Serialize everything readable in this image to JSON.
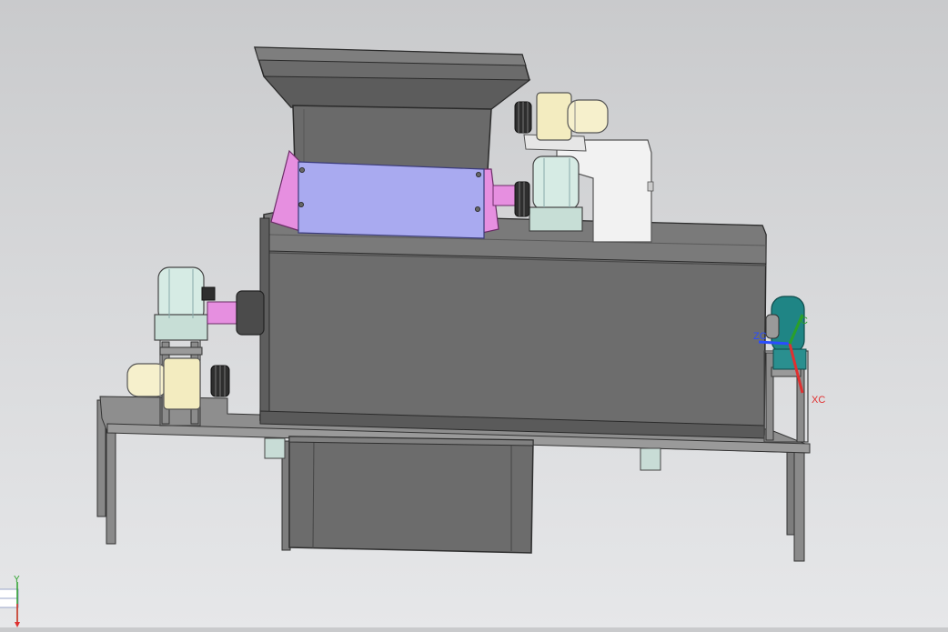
{
  "viewport": {
    "background_top": "#c9cacc",
    "background_bottom": "#e6e7e9"
  },
  "model": {
    "colors": {
      "body": "#6e6e6e",
      "frame": "#8c8c8c",
      "hopper": "#6a6a6a",
      "panel": "#a9aaf0",
      "pink": "#e68fe0",
      "bearing": "#d6ebe4",
      "motor": "#f3ecc0",
      "bracket": "#f2f2f2",
      "teal_bearing": "#1f8585"
    }
  },
  "wcs_triad": {
    "zc_label": "ZC",
    "xc_label": "XC",
    "yc_label": "C",
    "z_color": "#2a4dff",
    "x_color": "#e03030",
    "y_color": "#2aa02a"
  },
  "view_triad": {
    "y_label": "Y",
    "y_color": "#2aa02a",
    "down_color": "#e03030"
  }
}
